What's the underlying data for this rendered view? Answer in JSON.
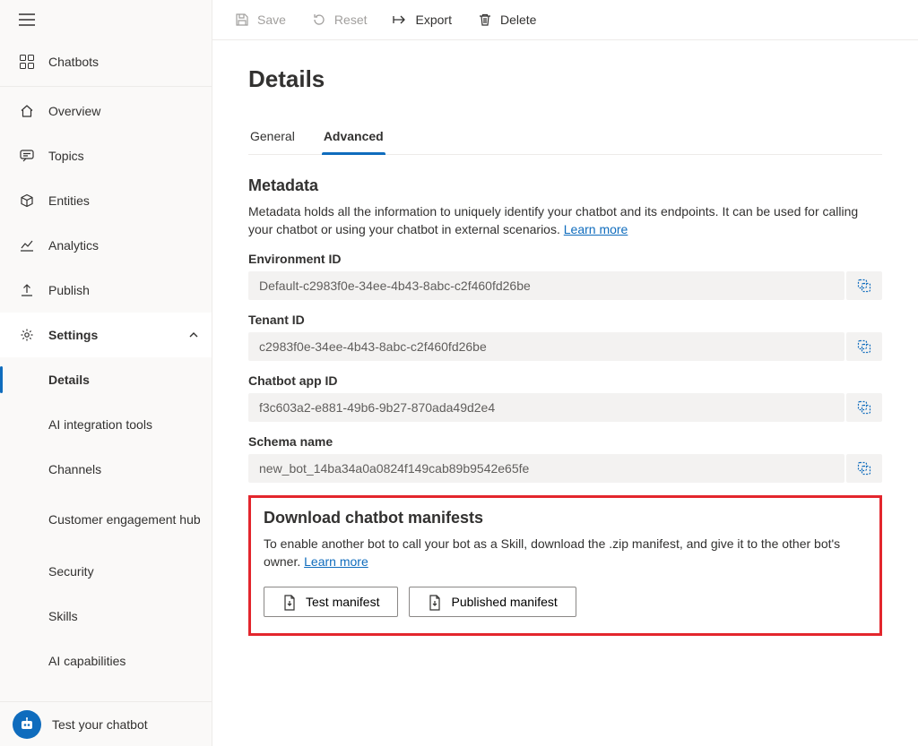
{
  "sidebar": {
    "items": [
      {
        "key": "chatbots",
        "label": "Chatbots"
      },
      {
        "key": "overview",
        "label": "Overview"
      },
      {
        "key": "topics",
        "label": "Topics"
      },
      {
        "key": "entities",
        "label": "Entities"
      },
      {
        "key": "analytics",
        "label": "Analytics"
      },
      {
        "key": "publish",
        "label": "Publish"
      },
      {
        "key": "settings",
        "label": "Settings"
      }
    ],
    "settings_children": [
      {
        "key": "details",
        "label": "Details"
      },
      {
        "key": "ai-integration",
        "label": "AI integration tools"
      },
      {
        "key": "channels",
        "label": "Channels"
      },
      {
        "key": "cust-eng",
        "label": "Customer engagement hub"
      },
      {
        "key": "security",
        "label": "Security"
      },
      {
        "key": "skills",
        "label": "Skills"
      },
      {
        "key": "ai-capabilities",
        "label": "AI capabilities"
      }
    ],
    "footer": {
      "label": "Test your chatbot"
    }
  },
  "commands": {
    "save": "Save",
    "reset": "Reset",
    "export": "Export",
    "delete": "Delete"
  },
  "page": {
    "title": "Details"
  },
  "tabs": {
    "general": "General",
    "advanced": "Advanced"
  },
  "metadata": {
    "heading": "Metadata",
    "desc_pre": "Metadata holds all the information to uniquely identify your chatbot and its endpoints. It can be used for calling your chatbot or using your chatbot in external scenarios. ",
    "learn_more": "Learn more",
    "fields": [
      {
        "label": "Environment ID",
        "value": "Default-c2983f0e-34ee-4b43-8abc-c2f460fd26be"
      },
      {
        "label": "Tenant ID",
        "value": "c2983f0e-34ee-4b43-8abc-c2f460fd26be"
      },
      {
        "label": "Chatbot app ID",
        "value": "f3c603a2-e881-49b6-9b27-870ada49d2e4"
      },
      {
        "label": "Schema name",
        "value": "new_bot_14ba34a0a0824f149cab89b9542e65fe"
      }
    ]
  },
  "manifests": {
    "heading": "Download chatbot manifests",
    "desc_pre": "To enable another bot to call your bot as a Skill, download the .zip manifest, and give it to the other bot's owner. ",
    "learn_more": "Learn more",
    "test_btn": "Test manifest",
    "published_btn": "Published manifest"
  }
}
